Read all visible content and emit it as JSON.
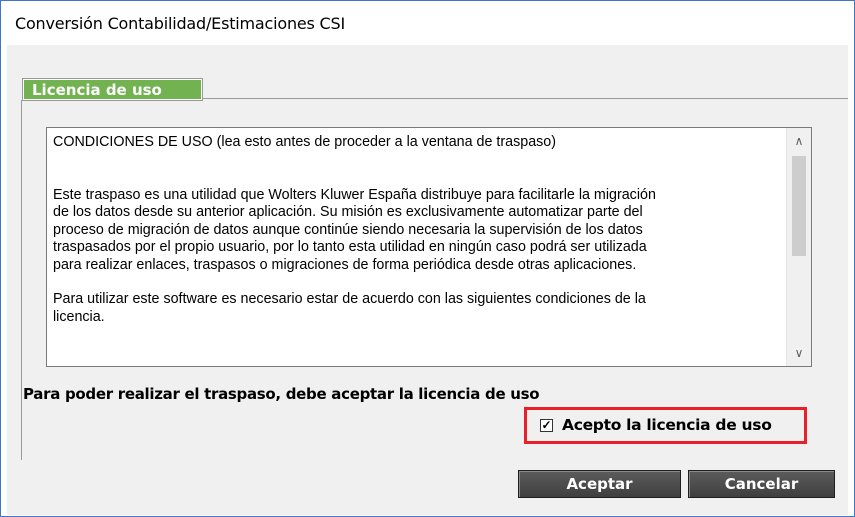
{
  "window": {
    "title": "Conversión Contabilidad/Estimaciones CSI"
  },
  "tab": {
    "label": "Licencia de uso"
  },
  "license": {
    "heading": "CONDICIONES DE USO (lea esto antes de proceder a la ventana de traspaso)",
    "paragraph1_lines": [
      "Este traspaso es una utilidad que Wolters Kluwer España distribuye para facilitarle la migración",
      "de los datos desde su anterior aplicación. Su misión es exclusivamente automatizar parte del",
      "proceso de migración de datos aunque continúe siendo necesaria la supervisión de los datos",
      "traspasados por el propio usuario, por lo tanto esta utilidad en ningún caso podrá ser utilizada",
      "para realizar enlaces, traspasos o migraciones de forma periódica desde otras aplicaciones."
    ],
    "paragraph2_lines": [
      "Para utilizar este software es necesario estar de acuerdo con las siguientes condiciones de la",
      "licencia."
    ]
  },
  "scrollbar": {
    "up": "∧",
    "down": "∨"
  },
  "notice": "Para poder realizar el traspaso, debe aceptar la licencia de uso",
  "accept": {
    "checked": true,
    "check_mark": "✓",
    "label": "Acepto la licencia de uso"
  },
  "buttons": {
    "ok": "Aceptar",
    "cancel": "Cancelar"
  },
  "colors": {
    "tab_green": "#72b250",
    "highlight_red": "#e8202a",
    "button_dark": "#4a4a4a"
  }
}
